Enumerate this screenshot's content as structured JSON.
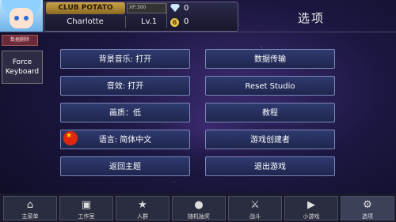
{
  "header": {
    "club_name": "CLUB POTATO",
    "xp_label": "XP:300",
    "player_name": "Charlotte",
    "level": "Lv.1",
    "gems": "0",
    "coin_icon_label": "6",
    "coins": "0",
    "page_title": "选项"
  },
  "side": {
    "delete_data": "数据删除",
    "force_keyboard": "Force Keyboard"
  },
  "options": {
    "bgm": "背景音乐: 打开",
    "sfx": "音效: 打开",
    "quality": "画质：低",
    "language": "语言: 简体中文",
    "return_home": "返回主题",
    "data_transfer": "数据传输",
    "reset_studio": "Reset Studio",
    "tutorial": "教程",
    "creators": "游戏创建者",
    "quit": "退出游戏"
  },
  "nav": [
    {
      "label": "主菜单",
      "icon": "home-icon"
    },
    {
      "label": "工作室",
      "icon": "camera-icon"
    },
    {
      "label": "人群",
      "icon": "star-icon"
    },
    {
      "label": "随机抽奖",
      "icon": "planet-icon"
    },
    {
      "label": "战斗",
      "icon": "crossed-swords-icon"
    },
    {
      "label": "小游戏",
      "icon": "gamepad-icon"
    },
    {
      "label": "选项",
      "icon": "gear-icon"
    }
  ],
  "colors": {
    "button_fill": "#2f3a6e",
    "button_border": "#7d86b8",
    "club_gold": "#c9a24a"
  }
}
